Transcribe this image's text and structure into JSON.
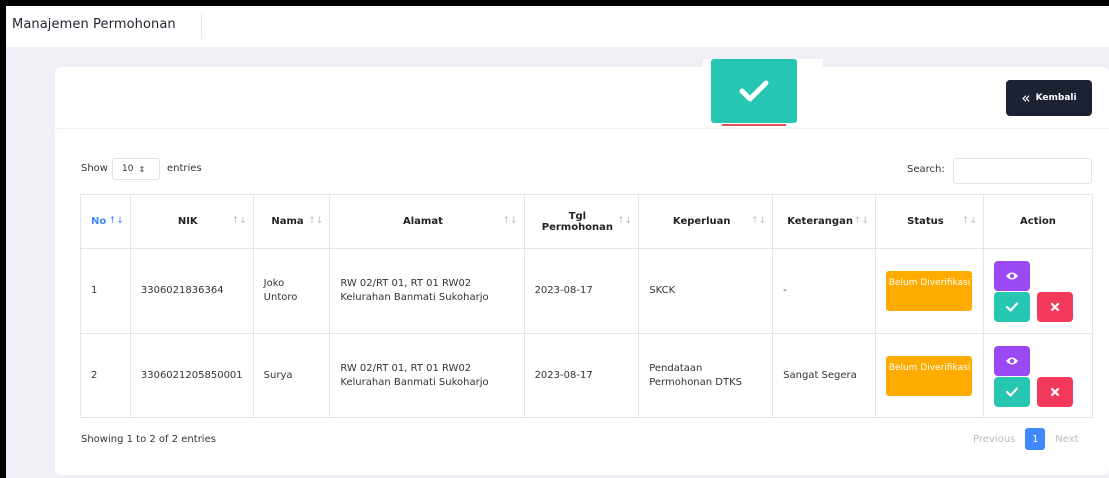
{
  "header": {
    "title": "Manajemen Permohonan"
  },
  "toolbar": {
    "back_label": "Kembali",
    "back_icon": "double-chevron-left-icon"
  },
  "alert": {
    "icon": "checkmark-icon",
    "color": "#26c6b3"
  },
  "controls": {
    "show_label": "Show",
    "page_length": "10",
    "entries_label": "entries",
    "search_label": "Search:",
    "search_value": ""
  },
  "table": {
    "columns": [
      "No",
      "NIK",
      "Nama",
      "Alamat",
      "Tgl Permohonan",
      "Keperluan",
      "Keterangan",
      "Status",
      "Action"
    ],
    "rows": [
      {
        "no": "1",
        "nik": "3306021836364",
        "nama": "Joko Untoro",
        "alamat": "RW 02/RT 01, RT 01 RW02 Kelurahan Banmati Sukoharjo",
        "tgl": "2023-08-17",
        "keperluan": "SKCK",
        "keterangan": "-",
        "status": "Belum Diverifikasi"
      },
      {
        "no": "2",
        "nik": "3306021205850001",
        "nama": "Surya",
        "alamat": "RW 02/RT 01, RT 01 RW02 Kelurahan Banmati Sukoharjo",
        "tgl": "2023-08-17",
        "keperluan": "Pendataan Permohonan DTKS",
        "keterangan": "Sangat Segera",
        "status": "Belum Diverifikasi"
      }
    ]
  },
  "footer": {
    "info": "Showing 1 to 2 of 2 entries",
    "prev_label": "Previous",
    "current_page": "1",
    "next_label": "Next"
  },
  "colors": {
    "primary": "#3f88ff",
    "status_pending": "#ffab00",
    "view": "#9b49f5",
    "approve": "#26c6b3",
    "reject": "#f2395b",
    "dark": "#1d2233"
  }
}
